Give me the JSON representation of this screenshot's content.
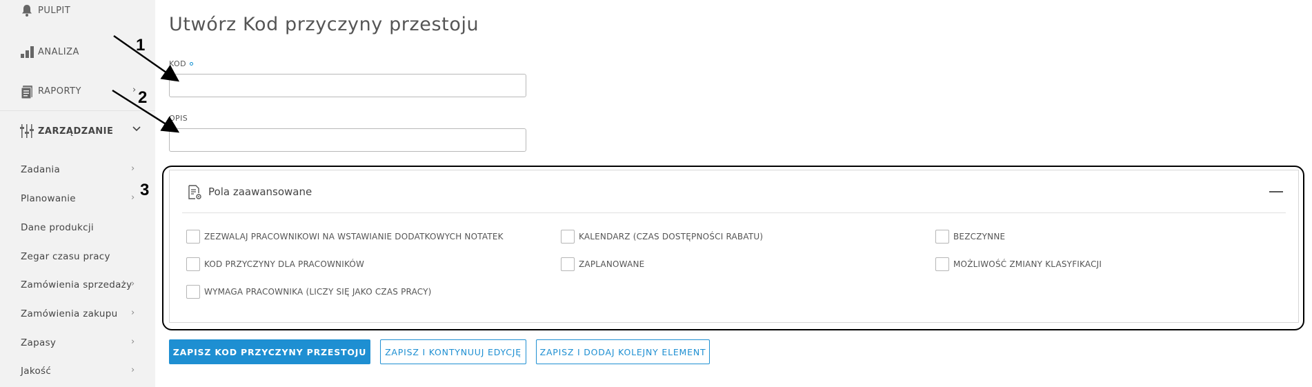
{
  "sidebar": {
    "top_items": [
      {
        "label": "PULPIT",
        "icon": "bell-icon"
      },
      {
        "label": "ANALIZA",
        "icon": "bar-chart-icon"
      },
      {
        "label": "RAPORTY",
        "icon": "report-icon"
      },
      {
        "label": "ZARZĄDZANIE",
        "icon": "sliders-icon"
      }
    ],
    "sub_items": [
      {
        "label": "Zadania"
      },
      {
        "label": "Planowanie"
      },
      {
        "label": "Dane produkcji"
      },
      {
        "label": "Zegar czasu pracy"
      },
      {
        "label": "Zamówienia sprzedaży"
      },
      {
        "label": "Zamówienia zakupu"
      },
      {
        "label": "Zapasy"
      },
      {
        "label": "Jakość"
      }
    ]
  },
  "main": {
    "title": "Utwórz Kod przyczyny przestoju",
    "fields": {
      "kod_label": "KOD",
      "kod_value": "",
      "opis_label": "OPIS",
      "opis_value": ""
    },
    "advanced": {
      "title": "Pola zaawansowane",
      "checkboxes": [
        "ZEZWALAJ PRACOWNIKOWI NA WSTAWIANIE DODATKOWYCH NOTATEK",
        "KALENDARZ (CZAS DOSTĘPNOŚCI RABATU)",
        "BEZCZYNNE",
        "KOD PRZYCZYNY DLA PRACOWNIKÓW",
        "ZAPLANOWANE",
        "MOŻLIWOŚĆ ZMIANY KLASYFIKACJI",
        "WYMAGA PRACOWNIKA (LICZY SIĘ JAKO CZAS PRACY)"
      ]
    },
    "buttons": {
      "save": "ZAPISZ KOD PRZYCZYNY PRZESTOJU",
      "save_continue": "ZAPISZ I KONTYNUUJ EDYCJĘ",
      "save_add": "ZAPISZ I DODAJ KOLEJNY ELEMENT"
    }
  },
  "annotations": [
    "1",
    "2",
    "3"
  ],
  "colors": {
    "accent": "#1e8fd2",
    "sidebar_bg": "#f2f2f2",
    "annotation": "#000000"
  }
}
